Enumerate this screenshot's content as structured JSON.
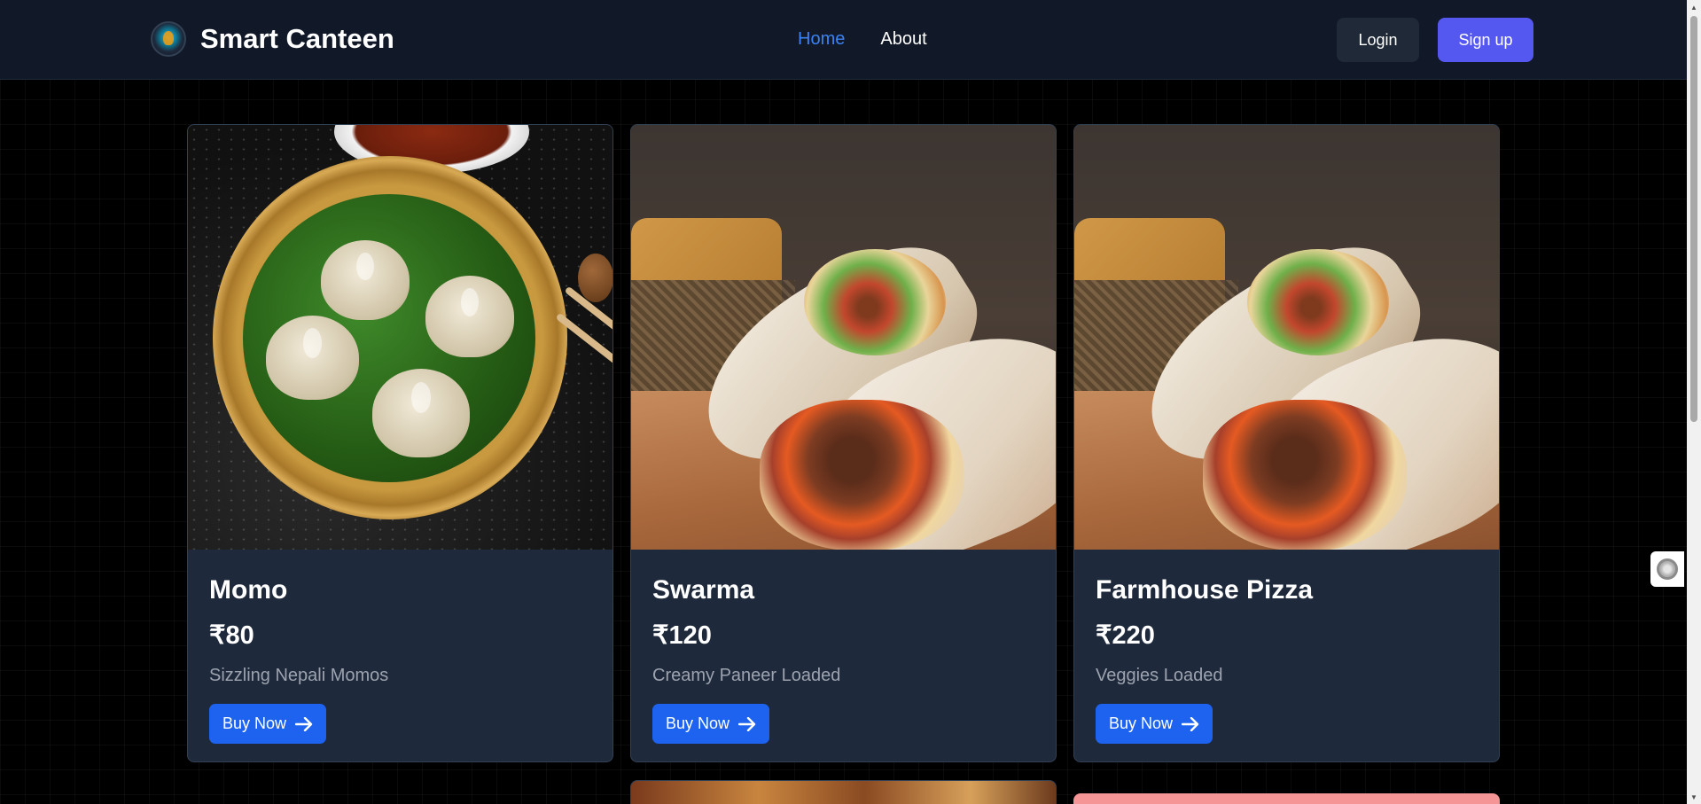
{
  "brand": {
    "name": "Smart Canteen",
    "logo_icon": "canteen-logo-icon"
  },
  "nav": {
    "links": [
      {
        "label": "Home",
        "active": true
      },
      {
        "label": "About",
        "active": false
      }
    ],
    "login_label": "Login",
    "signup_label": "Sign up"
  },
  "colors": {
    "accent": "#3b82f6",
    "signup": "#5558f0",
    "buy_button": "#1d63f0",
    "card_bg": "#1e293b",
    "nav_bg": "#111827"
  },
  "products": [
    {
      "name": "Momo",
      "price": "₹80",
      "description": "Sizzling Nepali Momos",
      "button_label": "Buy Now"
    },
    {
      "name": "Swarma",
      "price": "₹120",
      "description": "Creamy Paneer Loaded",
      "button_label": "Buy Now"
    },
    {
      "name": "Farmhouse Pizza",
      "price": "₹220",
      "description": "Veggies Loaded",
      "button_label": "Buy Now"
    }
  ]
}
